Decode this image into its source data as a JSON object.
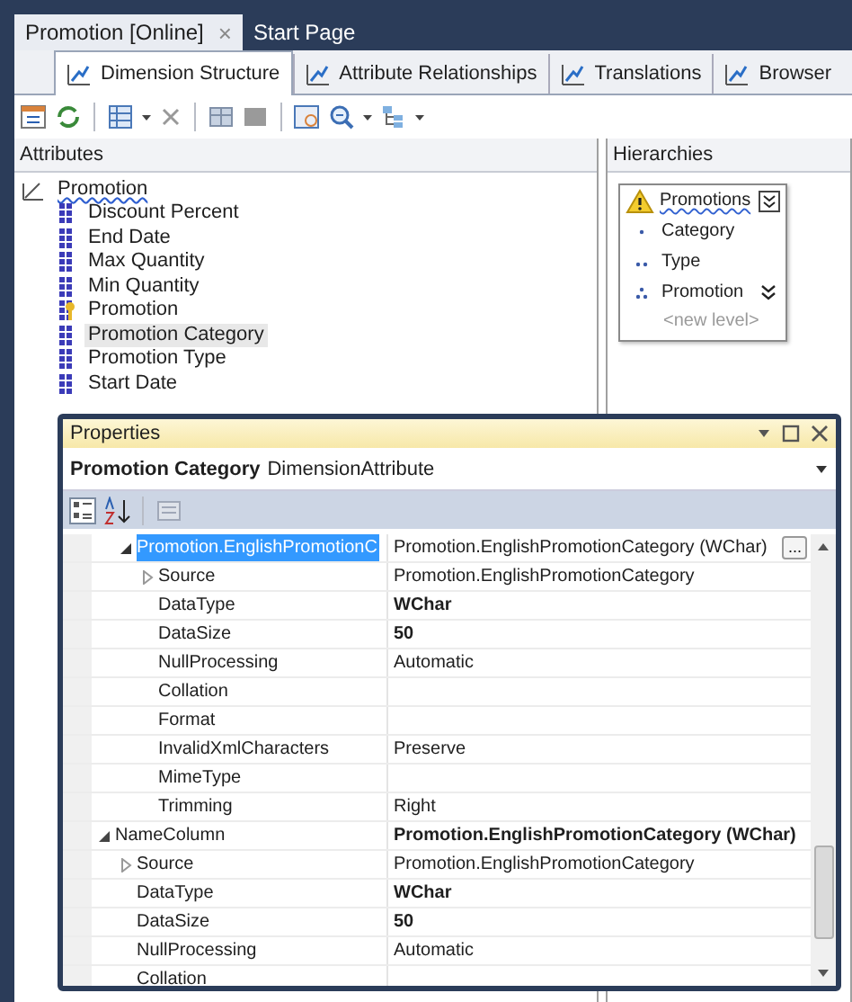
{
  "document_tabs": [
    {
      "label": "Promotion [Online]",
      "selected": true,
      "close": "×"
    },
    {
      "label": "Start Page",
      "selected": false
    }
  ],
  "designer_tabs": [
    {
      "label": "Dimension Structure",
      "selected": true
    },
    {
      "label": "Attribute Relationships",
      "selected": false
    },
    {
      "label": "Translations",
      "selected": false
    },
    {
      "label": "Browser",
      "selected": false
    }
  ],
  "attributes_pane": {
    "title": "Attributes",
    "dimension": {
      "label": "Promotion",
      "error": true
    },
    "items": [
      {
        "label": "Discount Percent",
        "key": false,
        "selected": false
      },
      {
        "label": "End Date",
        "key": false,
        "selected": false
      },
      {
        "label": "Max Quantity",
        "key": false,
        "selected": false
      },
      {
        "label": "Min Quantity",
        "key": false,
        "selected": false
      },
      {
        "label": "Promotion",
        "key": true,
        "selected": false
      },
      {
        "label": "Promotion Category",
        "key": false,
        "selected": true
      },
      {
        "label": "Promotion Type",
        "key": false,
        "selected": false
      },
      {
        "label": "Start Date",
        "key": false,
        "selected": false
      }
    ]
  },
  "hierarchies_pane": {
    "title": "Hierarchies",
    "hierarchy": {
      "name": "Promotions",
      "warning": true,
      "levels": [
        {
          "label": "Category",
          "kind": "first",
          "expand": false
        },
        {
          "label": "Type",
          "kind": "second",
          "expand": false
        },
        {
          "label": "Promotion",
          "kind": "third",
          "expand": true
        }
      ],
      "new_level": "<new level>"
    }
  },
  "properties": {
    "title": "Properties",
    "object_name": "Promotion Category",
    "object_type": "DimensionAttribute",
    "rows": [
      {
        "children": [
          {
            "name": "Promotion.EnglishPromotionC",
            "value": "Promotion.EnglishPromotionCategory (WChar)",
            "non_default": false,
            "selected": true,
            "expanded": true,
            "ellipsis": "...",
            "children": [
              {
                "name": "Source",
                "value": "Promotion.EnglishPromotionCategory",
                "non_default": false,
                "selected": false,
                "expanded": false
              },
              {
                "name": "DataType",
                "value": "WChar",
                "non_default": true,
                "selected": false
              },
              {
                "name": "DataSize",
                "value": "50",
                "non_default": true,
                "selected": false
              },
              {
                "name": "NullProcessing",
                "value": "Automatic",
                "non_default": false,
                "selected": false
              },
              {
                "name": "Collation",
                "selected": false
              },
              {
                "name": "Format",
                "selected": false
              },
              {
                "name": "InvalidXmlCharacters",
                "value": "Preserve",
                "non_default": false,
                "selected": false
              },
              {
                "name": "MimeType",
                "selected": false
              },
              {
                "name": "Trimming",
                "value": "Right",
                "non_default": false,
                "selected": false
              }
            ]
          }
        ]
      },
      {
        "name": "NameColumn",
        "value": "Promotion.EnglishPromotionCategory (WChar)",
        "non_default": true,
        "selected": false,
        "expanded": true,
        "children": [
          {
            "name": "Source",
            "value": "Promotion.EnglishPromotionCategory",
            "non_default": false,
            "selected": false,
            "expanded": false
          },
          {
            "name": "DataType",
            "value": "WChar",
            "non_default": true,
            "selected": false
          },
          {
            "name": "DataSize",
            "value": "50",
            "non_default": true,
            "selected": false
          },
          {
            "name": "NullProcessing",
            "value": "Automatic",
            "non_default": false,
            "selected": false
          },
          {
            "name": "Collation",
            "selected": false
          }
        ]
      }
    ]
  }
}
